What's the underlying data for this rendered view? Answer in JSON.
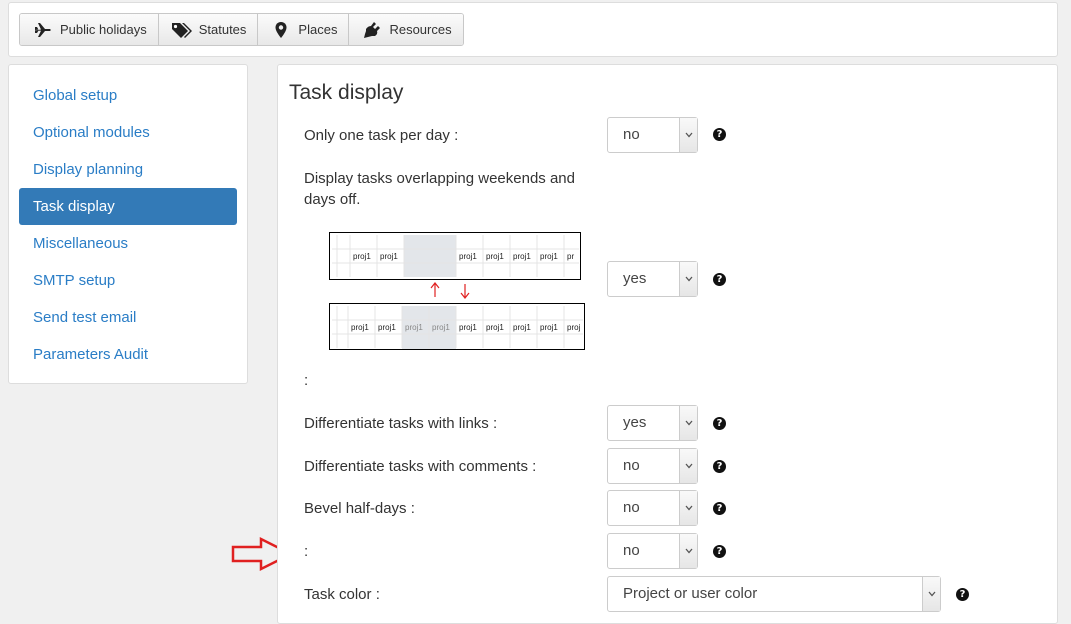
{
  "toolbar": {
    "buttons": [
      {
        "label": "Public holidays",
        "icon": "plane-icon"
      },
      {
        "label": "Statutes",
        "icon": "tags-icon"
      },
      {
        "label": "Places",
        "icon": "map-marker-icon"
      },
      {
        "label": "Resources",
        "icon": "plug-icon"
      }
    ]
  },
  "sidebar": {
    "items": [
      {
        "label": "Global setup",
        "active": false
      },
      {
        "label": "Optional modules",
        "active": false
      },
      {
        "label": "Display planning",
        "active": false
      },
      {
        "label": "Task display",
        "active": true
      },
      {
        "label": "Miscellaneous",
        "active": false
      },
      {
        "label": "SMTP setup",
        "active": false
      },
      {
        "label": "Send test email",
        "active": false
      },
      {
        "label": "Parameters Audit",
        "active": false
      }
    ]
  },
  "main": {
    "title": "Task display",
    "settings": {
      "one_task_per_day": {
        "label": "Only one task per day :",
        "value": "no"
      },
      "overlap_weekends": {
        "label": "Display tasks overlapping weekends and days off.",
        "value": "yes"
      },
      "empty_label_1": ":",
      "links": {
        "label": "Differentiate tasks with links :",
        "value": "yes"
      },
      "comments": {
        "label": "Differentiate tasks with comments :",
        "value": "no"
      },
      "bevel": {
        "label": "Bevel half-days :",
        "value": "no"
      },
      "unnamed": {
        "label": ":",
        "value": "no"
      },
      "task_color": {
        "label": "Task color :",
        "value": "Project or user color"
      }
    },
    "illustration": {
      "cell_label": "proj1",
      "cell_label_truncated": "pr",
      "top_row": [
        "",
        "proj1",
        "proj1",
        "",
        "",
        "proj1",
        "proj1",
        "proj1",
        "proj1",
        "pr"
      ],
      "bottom_row": [
        "",
        "proj1",
        "proj1",
        "proj1",
        "proj1",
        "proj1",
        "proj1",
        "proj1",
        "proj1",
        "proj"
      ]
    },
    "help_glyph": "?"
  },
  "colors": {
    "accent": "#337ab7",
    "link": "#2a7dc6",
    "annotation_red": "#e02020"
  }
}
